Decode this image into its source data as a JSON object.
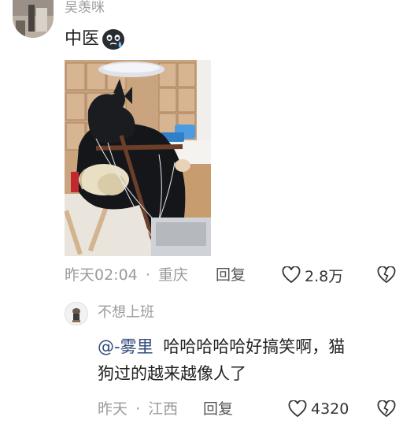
{
  "comment": {
    "username": "吴羡咪",
    "text": "中医",
    "emoji": "crying-face-emoji",
    "meta_time": "昨天02:04",
    "meta_sep": "·",
    "meta_location": "重庆",
    "reply_label": "回复",
    "like_count": "2.8万",
    "photo_icon": "dog-acupuncture-photo"
  },
  "reply": {
    "username": "不想上班",
    "mention": "@-雾里",
    "text_line1": "哈哈哈哈哈好搞笑啊，猫",
    "text_line2": "狗过的越来越像人了",
    "meta_time": "昨天",
    "meta_sep": "·",
    "meta_location": "江西",
    "reply_label": "回复",
    "like_count": "4320"
  },
  "colors": {
    "mention": "#2f4a7a",
    "meta": "#9a9a9a",
    "text": "#222222"
  }
}
